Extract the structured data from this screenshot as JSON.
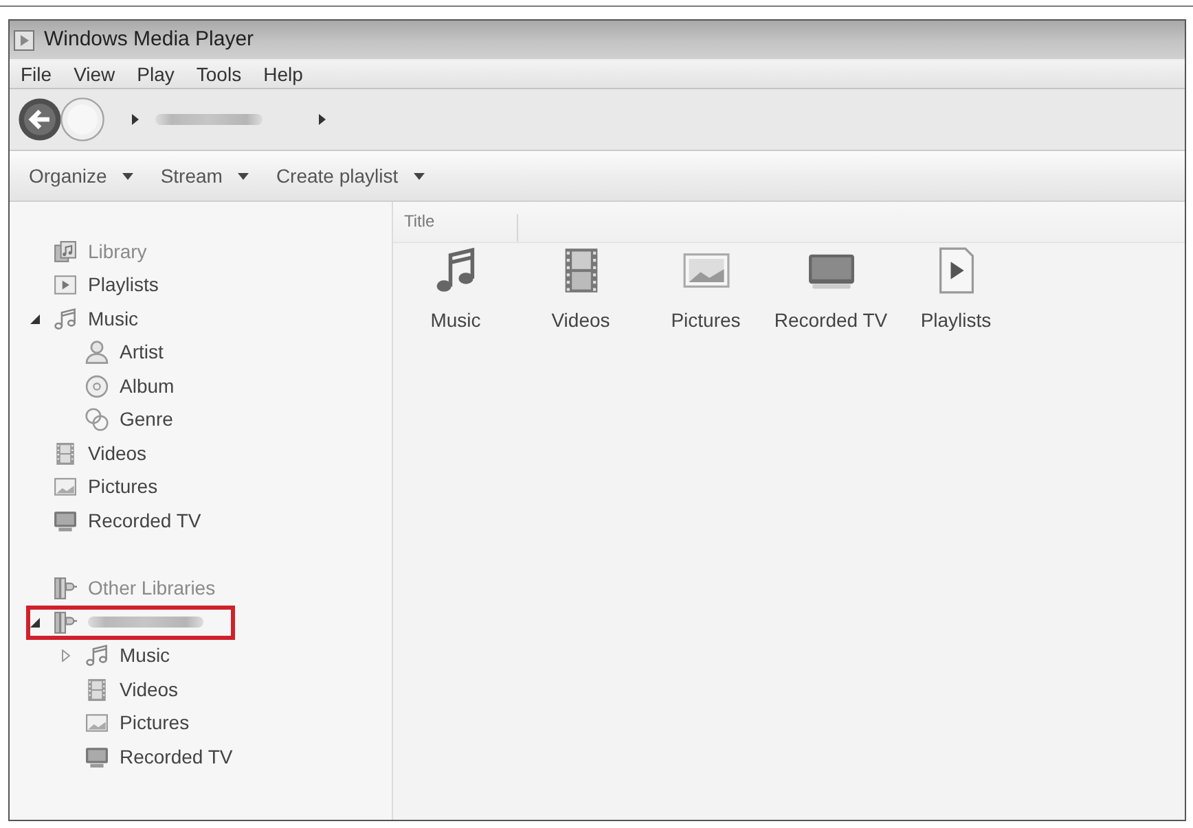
{
  "window": {
    "title": "Windows Media Player"
  },
  "menu": [
    "File",
    "View",
    "Play",
    "Tools",
    "Help"
  ],
  "address_bar": {
    "blurred": true
  },
  "toolbar": [
    "Organize",
    "Stream",
    "Create playlist"
  ],
  "sidebar": {
    "sections": [
      {
        "title": "Library",
        "kind": "library",
        "items": [
          {
            "label": "Playlists",
            "kind": "playlists"
          },
          {
            "label": "Music",
            "kind": "music",
            "expanded": true,
            "children": [
              {
                "label": "Artist",
                "kind": "artist"
              },
              {
                "label": "Album",
                "kind": "album"
              },
              {
                "label": "Genre",
                "kind": "genre"
              }
            ]
          },
          {
            "label": "Videos",
            "kind": "videos"
          },
          {
            "label": "Pictures",
            "kind": "pictures"
          },
          {
            "label": "Recorded TV",
            "kind": "recorded_tv"
          }
        ]
      },
      {
        "title": "Other Libraries",
        "kind": "other_libraries",
        "items": [
          {
            "kind": "other_libraries",
            "blurred": true,
            "expanded": true,
            "highlighted": true,
            "children": [
              {
                "label": "Music",
                "kind": "music",
                "expanded": false
              },
              {
                "label": "Videos",
                "kind": "videos"
              },
              {
                "label": "Pictures",
                "kind": "pictures"
              },
              {
                "label": "Recorded TV",
                "kind": "recorded_tv"
              }
            ]
          }
        ]
      }
    ]
  },
  "content": {
    "columns": [
      "Title"
    ],
    "tiles": [
      {
        "label": "Music",
        "kind": "music"
      },
      {
        "label": "Videos",
        "kind": "videos"
      },
      {
        "label": "Pictures",
        "kind": "pictures"
      },
      {
        "label": "Recorded TV",
        "kind": "recorded_tv"
      },
      {
        "label": "Playlists",
        "kind": "playlists"
      }
    ]
  }
}
